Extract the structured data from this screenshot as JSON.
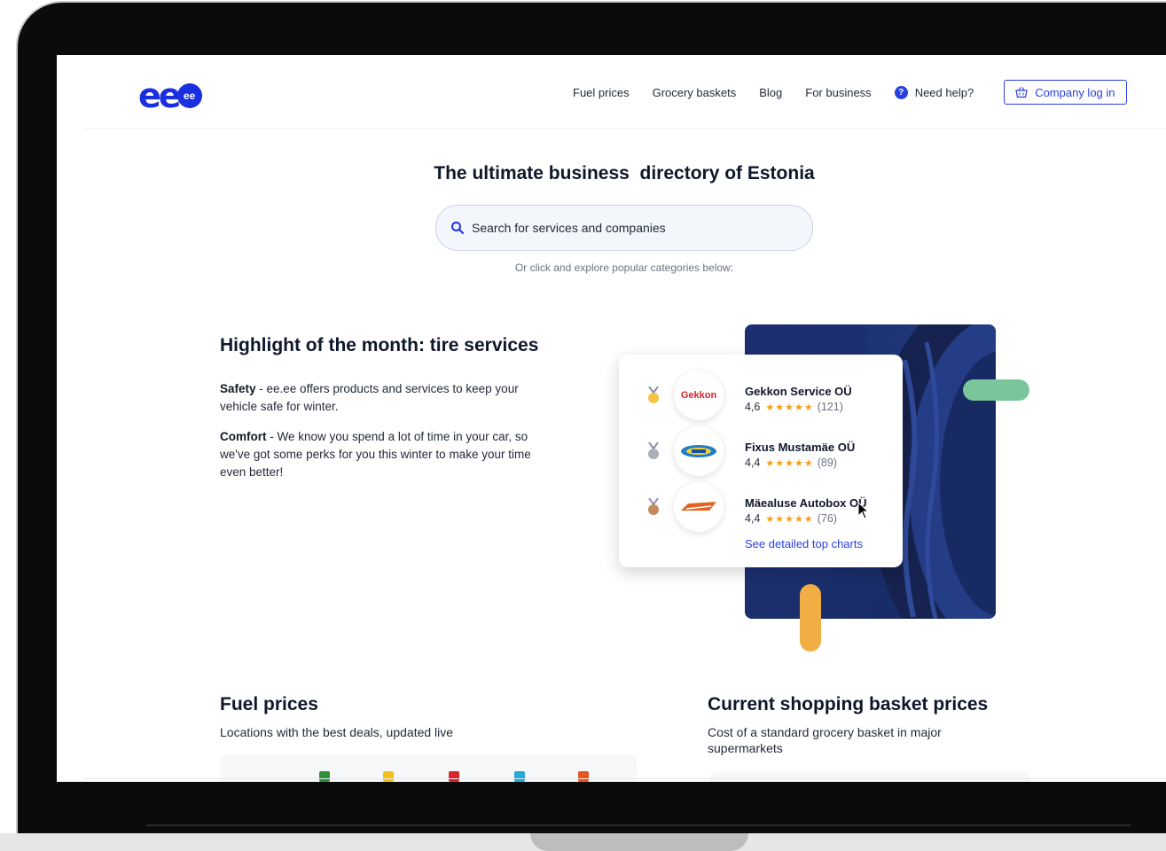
{
  "logo": {
    "text": "ee",
    "badge": "ee"
  },
  "nav": {
    "links": [
      "Fuel prices",
      "Grocery baskets",
      "Blog",
      "For business"
    ],
    "help_label": "Need help?",
    "company_login_label": "Company log in"
  },
  "hero": {
    "title": "The ultimate business  directory of Estonia",
    "search_placeholder": "Search for services and companies",
    "explore_hint": "Or click and explore popular categories below:"
  },
  "highlight": {
    "title": "Highlight of the month: tire services",
    "safety_label": "Safety",
    "safety_text": " - ee.ee offers products and services to keep your vehicle safe for winter.",
    "comfort_label": "Comfort",
    "comfort_text": " - We know you spend a lot of time in your car, so we've got some perks for you this winter to make your time even better!"
  },
  "top_chart": {
    "companies": [
      {
        "name": "Gekkon Service OÜ",
        "rating": "4,6",
        "stars": "★★★★★",
        "count": "(121)",
        "medal": "gold",
        "logo_text": "Gekkon"
      },
      {
        "name": "Fixus Mustamäe OÜ",
        "rating": "4,4",
        "stars": "★★★★★",
        "count": "(89)",
        "medal": "silver"
      },
      {
        "name": "Mäealuse Autobox OÜ",
        "rating": "4,4",
        "stars": "★★★★★",
        "count": "(76)",
        "medal": "bronze"
      }
    ],
    "see_link": "See detailed top charts"
  },
  "fuel": {
    "title": "Fuel prices",
    "subtitle": "Locations with the best deals, updated live"
  },
  "basket": {
    "title": "Current shopping basket prices",
    "subtitle": "Cost of a standard grocery basket in major supermarkets"
  },
  "colors": {
    "brand": "#1a2fe0",
    "link": "#2a3fe0",
    "star": "#f0a020",
    "green_accent": "#7bc59a",
    "yellow_accent": "#f0ae45",
    "tire_bg": "#1d2f73"
  }
}
